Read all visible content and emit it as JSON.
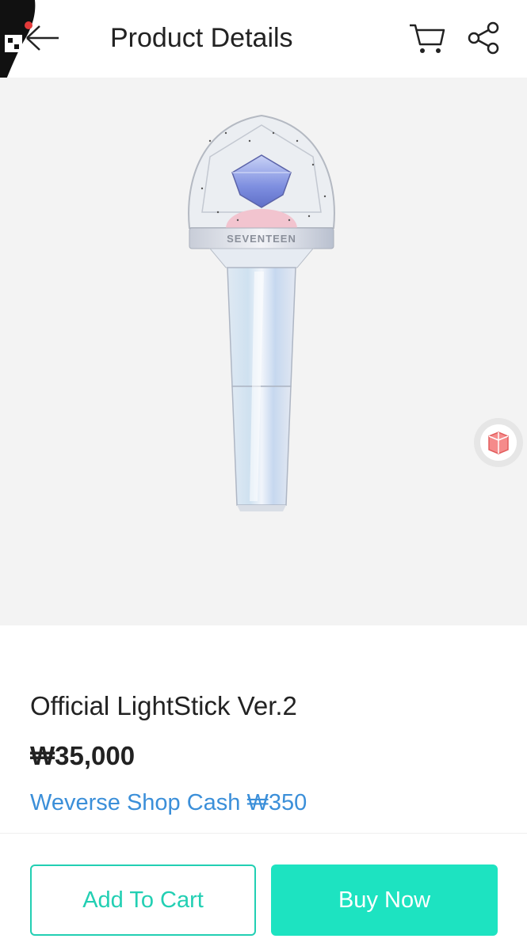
{
  "header": {
    "title": "Product Details",
    "back_icon": "back-arrow-icon",
    "cart_icon": "cart-icon",
    "share_icon": "share-icon"
  },
  "product": {
    "name": "Official LightStick Ver.2",
    "price": "₩35,000",
    "cash": "Weverse Shop Cash ₩350",
    "image_brand_text": "SEVENTEEN"
  },
  "actions": {
    "add_to_cart": "Add To Cart",
    "buy_now": "Buy Now"
  },
  "colors": {
    "accent": "#1de3c1",
    "accent_outline": "#22cfb3",
    "link": "#3b8fd9",
    "image_bg": "#f3f3f3"
  }
}
